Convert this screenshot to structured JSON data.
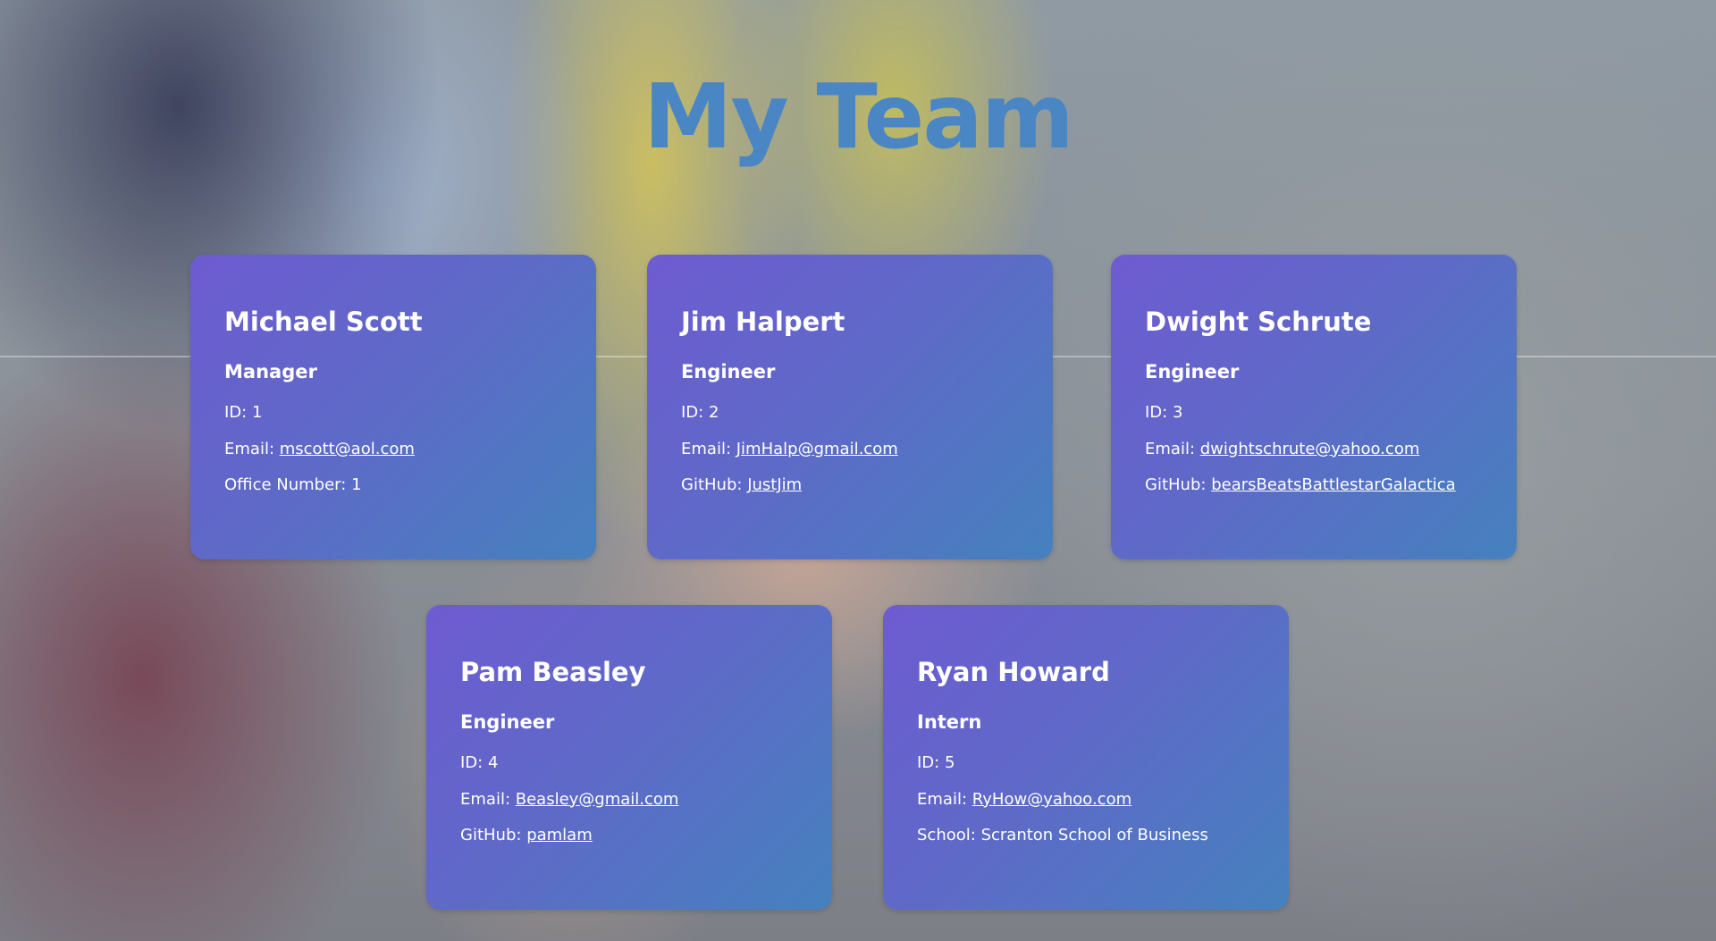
{
  "page": {
    "title": "My Team"
  },
  "team": [
    {
      "name": "Michael Scott",
      "role": "Manager",
      "id_label": "ID:",
      "id": "1",
      "email_label": "Email:",
      "email": "mscott@aol.com",
      "extra_label": "Office Number:",
      "extra": "1"
    },
    {
      "name": "Jim Halpert",
      "role": "Engineer",
      "id_label": "ID:",
      "id": "2",
      "email_label": "Email:",
      "email": "JimHalp@gmail.com",
      "extra_label": "GitHub:",
      "extra": "JustJim"
    },
    {
      "name": "Dwight Schrute",
      "role": "Engineer",
      "id_label": "ID:",
      "id": "3",
      "email_label": "Email:",
      "email": "dwightschrute@yahoo.com",
      "extra_label": "GitHub:",
      "extra": "bearsBeatsBattlestarGalactica"
    },
    {
      "name": "Pam Beasley",
      "role": "Engineer",
      "id_label": "ID:",
      "id": "4",
      "email_label": "Email:",
      "email": "Beasley@gmail.com",
      "extra_label": "GitHub:",
      "extra": "pamlam"
    },
    {
      "name": "Ryan Howard",
      "role": "Intern",
      "id_label": "ID:",
      "id": "5",
      "email_label": "Email:",
      "email": "RyHow@yahoo.com",
      "extra_label": "School:",
      "extra": "Scranton School of Business"
    }
  ],
  "colors": {
    "title": "#4a86c4",
    "card_gradient_start": "#6e5bd1",
    "card_gradient_end": "#4581be",
    "card_text": "#ffffff"
  }
}
